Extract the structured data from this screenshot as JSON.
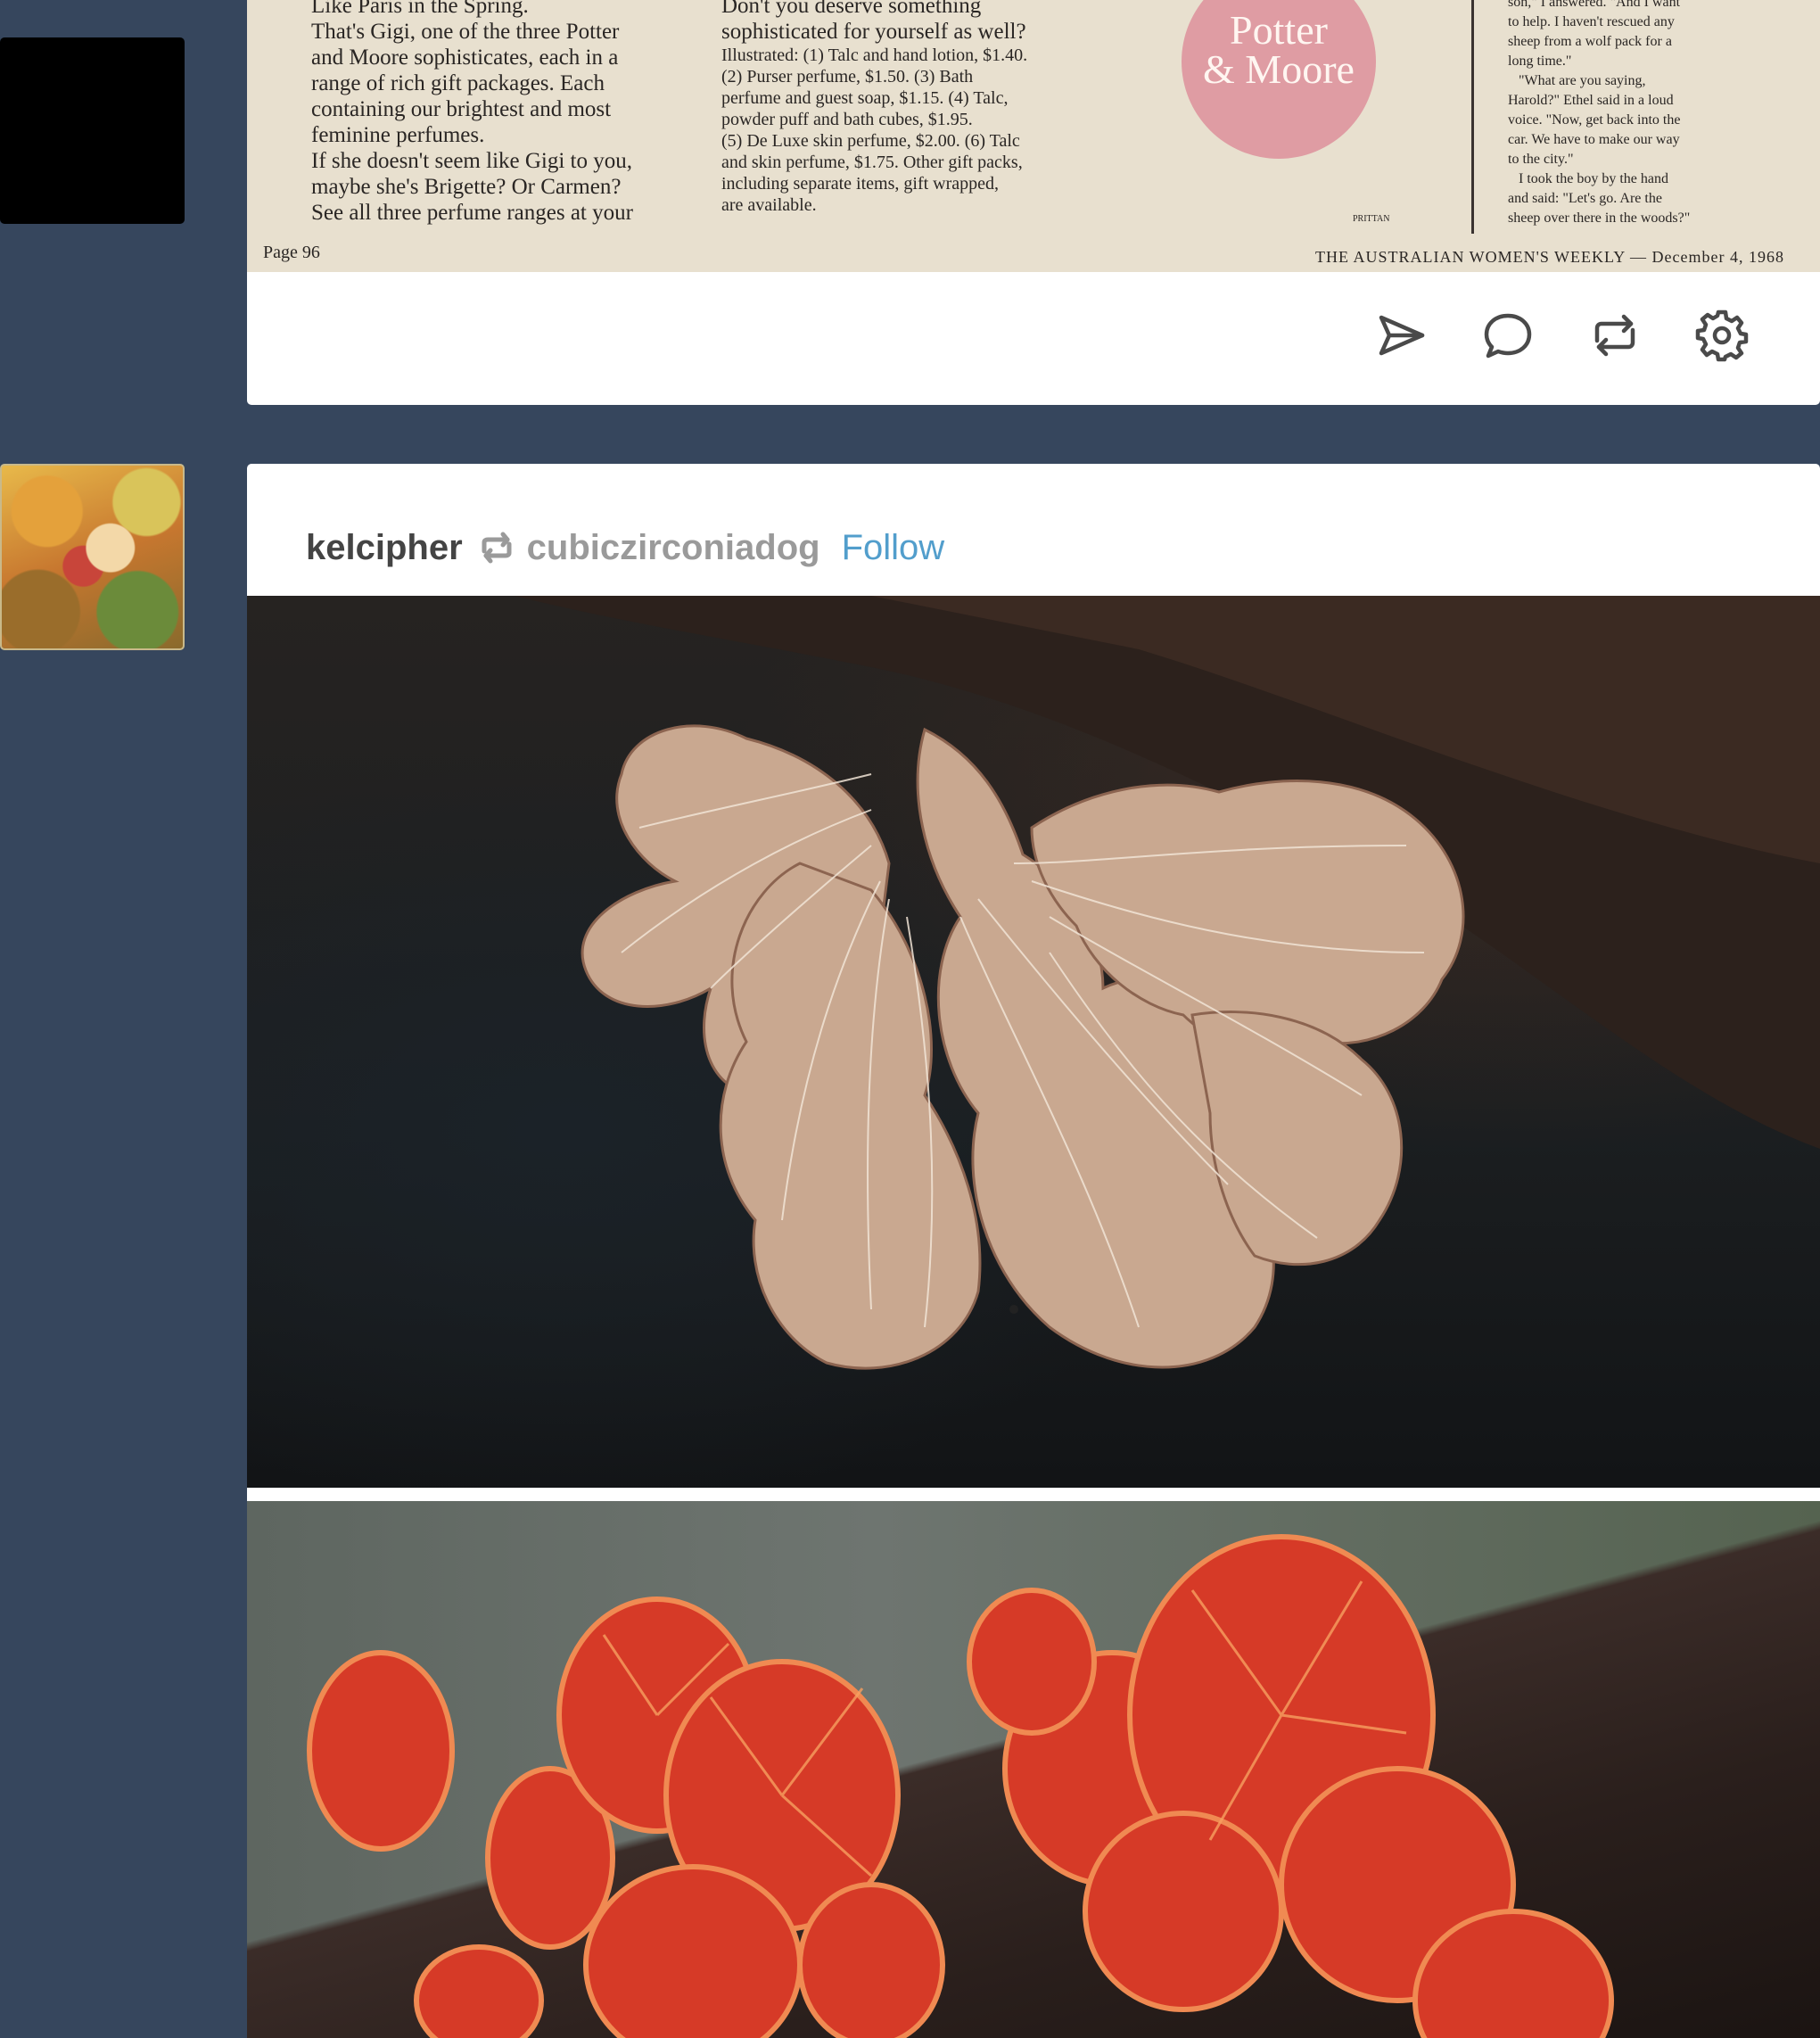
{
  "dashboard": {
    "background_color": "#36465d",
    "accent_color": "#529ecc"
  },
  "post1": {
    "newspaper": {
      "column1_text": "Like Paris in the Spring.\nThat's Gigi, one of the three Potter\nand Moore sophisticates, each in a\nrange of rich gift packages. Each\ncontaining our brightest and most\nfeminine perfumes.\nIf she doesn't seem like Gigi to you,\nmaybe she's Brigette? Or Carmen?\nSee all three perfume ranges at your",
      "column2_lead": "Don't you deserve something\nsophisticated for yourself as well?",
      "column2_text": "Illustrated: (1) Talc and hand lotion, $1.40.\n(2) Purser perfume, $1.50. (3) Bath\nperfume and guest soap, $1.15. (4) Talc,\npowder puff and bath cubes, $1.95.\n(5) De Luxe skin perfume, $2.00. (6) Talc\nand skin perfume, $1.75. Other gift packs,\nincluding separate items, gift wrapped,\nare available.",
      "column3_text": "son,\" I answered. \"And I want\nto help. I haven't rescued any\nsheep from a wolf pack for a\nlong time.\"\n   \"What are you saying,\nHarold?\" Ethel said in a loud\nvoice. \"Now, get back into the\ncar. We have to make our way\nto the city.\"\n   I took the boy by the hand\nand said: \"Let's go. Are the\nsheep over there in the woods?\"",
      "logo_text": "Potter\n& Moore",
      "page_label": "Page 96",
      "footer_text": "THE AUSTRALIAN WOMEN'S WEEKLY — December 4, 1968",
      "credit": "PRITTAN"
    },
    "actions": [
      {
        "name": "share",
        "icon": "send-icon"
      },
      {
        "name": "reply",
        "icon": "comment-icon"
      },
      {
        "name": "reblog",
        "icon": "reblog-icon"
      },
      {
        "name": "settings",
        "icon": "gear-icon"
      }
    ]
  },
  "post2": {
    "author": "kelcipher",
    "source": "cubiczirconiadog",
    "follow_label": "Follow",
    "photos": [
      {
        "subject": "pale fan-shaped split-gill fungus on dark wood"
      },
      {
        "subject": "red cup-shaped fungi on a branch"
      }
    ]
  }
}
